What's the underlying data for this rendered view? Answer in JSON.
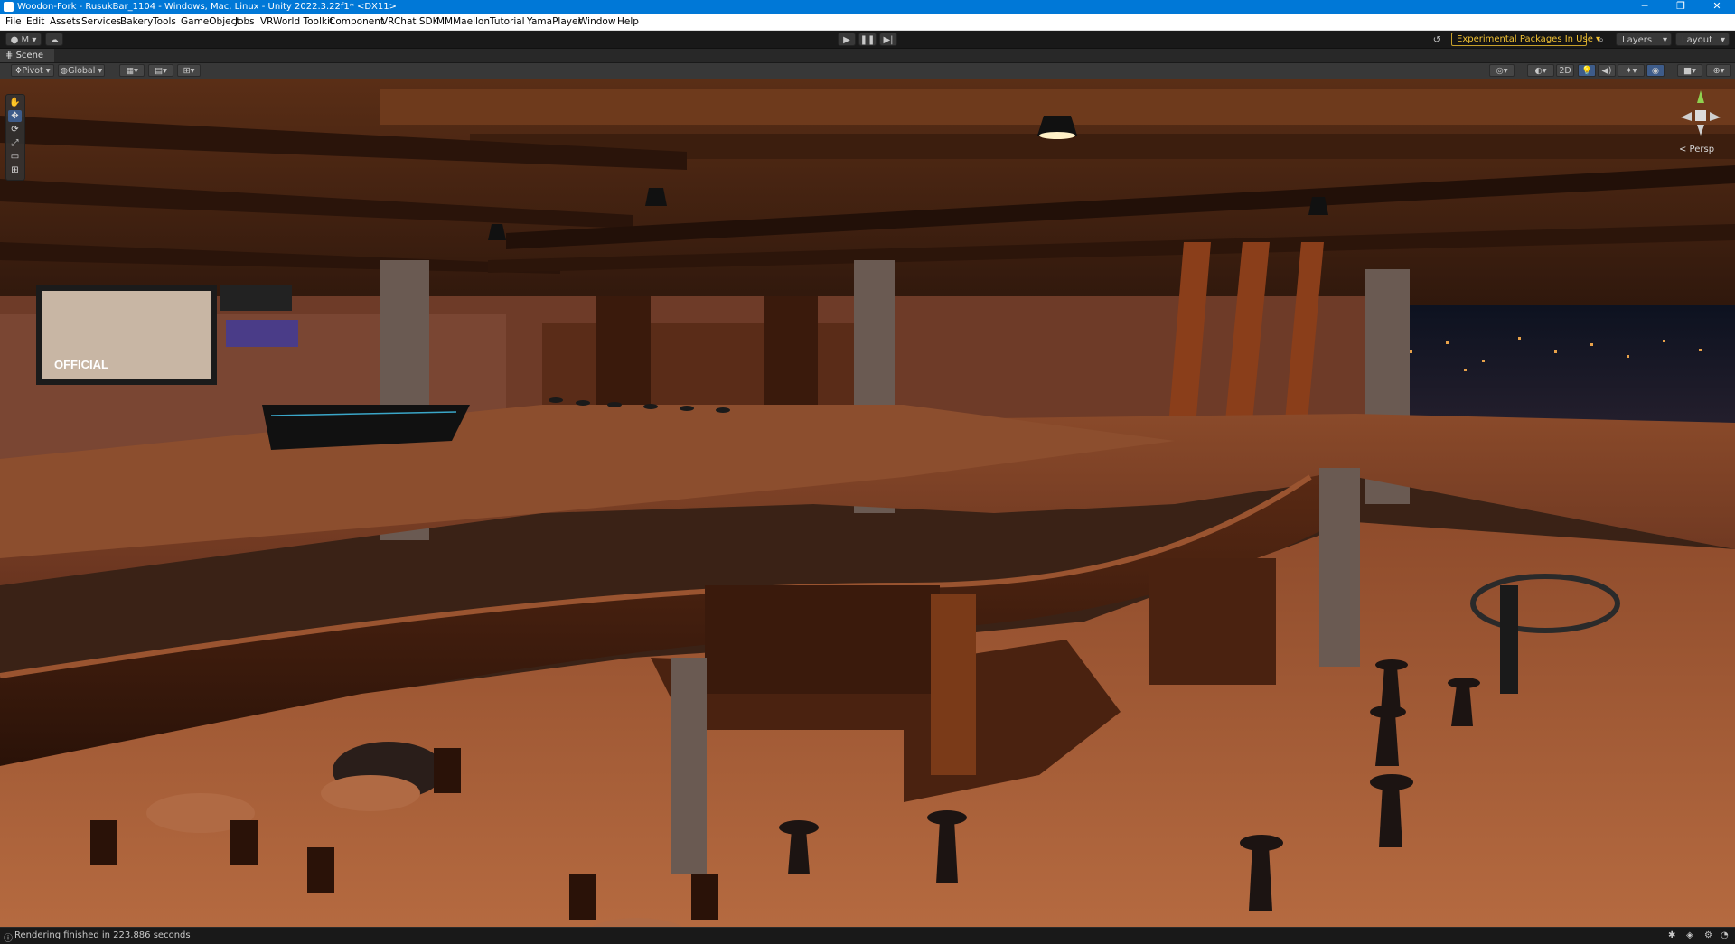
{
  "window": {
    "title": "Woodon-Fork - RusukBar_1104 - Windows, Mac, Linux - Unity 2022.3.22f1* <DX11>",
    "minimize": "─",
    "maximize": "❐",
    "close": "✕"
  },
  "menu": [
    "File",
    "Edit",
    "Assets",
    "Services",
    "Bakery",
    "Tools",
    "GameObject",
    "Jobs",
    "VRWorld Toolkit",
    "Component",
    "VRChat SDK",
    "MMMaellon",
    "Tutorial",
    "YamaPlayer",
    "Window",
    "Help"
  ],
  "toolbar": {
    "account": "M",
    "experimental": "Experimental Packages In Use",
    "layers": "Layers",
    "layout": "Layout"
  },
  "scene_tab": {
    "label": "Scene"
  },
  "scene_toolbar": {
    "pivot": "Pivot",
    "global": "Global",
    "mode_2d": "2D"
  },
  "viewport": {
    "camera_label": "< Persp",
    "sign_text": "OFFICIAL"
  },
  "status": {
    "message": "Rendering finished in 223.886 seconds"
  },
  "colors": {
    "titlebar": "#0078d7",
    "accent_warning": "#f2c233",
    "editor_bg": "#191919"
  }
}
